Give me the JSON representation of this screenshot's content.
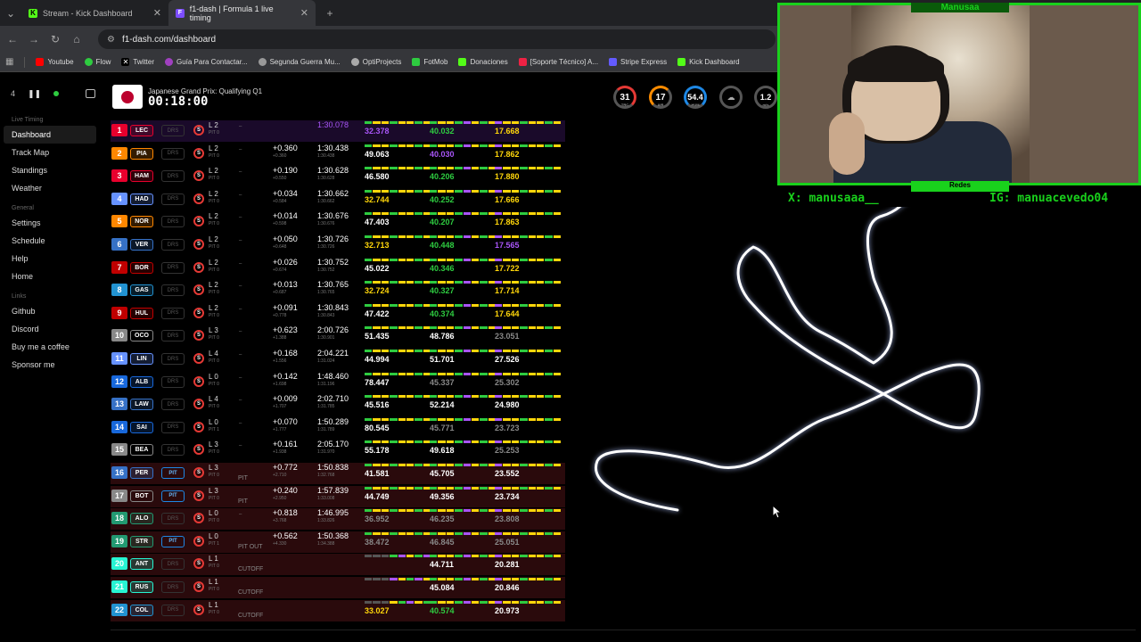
{
  "browser": {
    "tabs": [
      {
        "label": "Stream - Kick Dashboard",
        "icon": "kick-icon"
      },
      {
        "label": "f1-dash | Formula 1 live timing",
        "icon": "f1dash-icon"
      }
    ],
    "url": "f1-dash.com/dashboard",
    "bookmarks": [
      "Youtube",
      "Flow",
      "Twitter",
      "Guía Para Contactar...",
      "Segunda Guerra Mu...",
      "OptiProjects",
      "FotMob",
      "Donaciones",
      "[Soporte Técnico] A...",
      "Stripe Express",
      "Kick Dashboard"
    ]
  },
  "sidebar": {
    "count": "4",
    "groups": [
      {
        "title": "Live Timing",
        "items": [
          "Dashboard",
          "Track Map",
          "Standings",
          "Weather"
        ]
      },
      {
        "title": "General",
        "items": [
          "Settings",
          "Schedule",
          "Help",
          "Home"
        ]
      },
      {
        "title": "Links",
        "items": [
          "Github",
          "Discord",
          "Buy me a coffee",
          "Sponsor me"
        ]
      }
    ]
  },
  "header": {
    "session": "Japanese Grand Prix: Qualifying Q1",
    "timer": "00:18:00",
    "weather": [
      {
        "value": "31",
        "label": "TRC"
      },
      {
        "value": "17",
        "label": "AIR"
      },
      {
        "value": "54.4",
        "label": "HUM"
      },
      {
        "value": "",
        "label": ""
      },
      {
        "value": "1.2",
        "label": "m/s"
      }
    ]
  },
  "drivers": [
    {
      "pos": "1",
      "code": "LEC",
      "color": "#e8002d",
      "drs": "DRS",
      "lap": "L 2",
      "pit": "PIT 0",
      "status": "",
      "gap": "",
      "gapSub": "",
      "best": "1:30.078",
      "bestSub": "",
      "s1": "32.378",
      "s2": "40.032",
      "s3": "17.668",
      "s1c": "#a855f7",
      "s2c": "#2ecc40",
      "s3c": "#ffd60a",
      "rowStyle": "fastest"
    },
    {
      "pos": "2",
      "code": "PIA",
      "color": "#ff8700",
      "drs": "DRS",
      "lap": "L 2",
      "pit": "PIT 0",
      "status": "",
      "gap": "+0.360",
      "gapSub": "+0.360",
      "best": "1:30.438",
      "bestSub": "1:30.438",
      "s1": "49.063",
      "s2": "40.030",
      "s3": "17.862",
      "s1c": "#fff",
      "s2c": "#a855f7",
      "s3c": "#ffd60a",
      "rowStyle": ""
    },
    {
      "pos": "3",
      "code": "HAM",
      "color": "#e8002d",
      "drs": "DRS",
      "lap": "L 2",
      "pit": "PIT 0",
      "status": "",
      "gap": "+0.190",
      "gapSub": "+0.550",
      "best": "1:30.628",
      "bestSub": "1:30.628",
      "s1": "46.580",
      "s2": "40.206",
      "s3": "17.880",
      "s1c": "#fff",
      "s2c": "#2ecc40",
      "s3c": "#ffd60a",
      "rowStyle": ""
    },
    {
      "pos": "4",
      "code": "HAD",
      "color": "#6692ff",
      "drs": "DRS",
      "lap": "L 2",
      "pit": "PIT 0",
      "status": "",
      "gap": "+0.034",
      "gapSub": "+0.584",
      "best": "1:30.662",
      "bestSub": "1:30.662",
      "s1": "32.744",
      "s2": "40.252",
      "s3": "17.666",
      "s1c": "#ffd60a",
      "s2c": "#2ecc40",
      "s3c": "#ffd60a",
      "rowStyle": ""
    },
    {
      "pos": "5",
      "code": "NOR",
      "color": "#ff8700",
      "drs": "DRS",
      "lap": "L 2",
      "pit": "PIT 0",
      "status": "",
      "gap": "+0.014",
      "gapSub": "+0.598",
      "best": "1:30.676",
      "bestSub": "1:30.676",
      "s1": "47.403",
      "s2": "40.207",
      "s3": "17.863",
      "s1c": "#fff",
      "s2c": "#2ecc40",
      "s3c": "#ffd60a",
      "rowStyle": ""
    },
    {
      "pos": "6",
      "code": "VER",
      "color": "#3671c6",
      "drs": "DRS",
      "lap": "L 2",
      "pit": "PIT 0",
      "status": "",
      "gap": "+0.050",
      "gapSub": "+0.648",
      "best": "1:30.726",
      "bestSub": "1:30.726",
      "s1": "32.713",
      "s2": "40.448",
      "s3": "17.565",
      "s1c": "#ffd60a",
      "s2c": "#2ecc40",
      "s3c": "#a855f7",
      "rowStyle": ""
    },
    {
      "pos": "7",
      "code": "BOR",
      "color": "#c00000",
      "drs": "DRS",
      "lap": "L 2",
      "pit": "PIT 0",
      "status": "",
      "gap": "+0.026",
      "gapSub": "+0.674",
      "best": "1:30.752",
      "bestSub": "1:30.752",
      "s1": "45.022",
      "s2": "40.346",
      "s3": "17.722",
      "s1c": "#fff",
      "s2c": "#2ecc40",
      "s3c": "#ffd60a",
      "rowStyle": ""
    },
    {
      "pos": "8",
      "code": "GAS",
      "color": "#2293d1",
      "drs": "DRS",
      "lap": "L 2",
      "pit": "PIT 0",
      "status": "",
      "gap": "+0.013",
      "gapSub": "+0.687",
      "best": "1:30.765",
      "bestSub": "1:30.765",
      "s1": "32.724",
      "s2": "40.327",
      "s3": "17.714",
      "s1c": "#ffd60a",
      "s2c": "#2ecc40",
      "s3c": "#ffd60a",
      "rowStyle": ""
    },
    {
      "pos": "9",
      "code": "HUL",
      "color": "#c00000",
      "drs": "DRS",
      "lap": "L 2",
      "pit": "PIT 0",
      "status": "",
      "gap": "+0.091",
      "gapSub": "+0.778",
      "best": "1:30.843",
      "bestSub": "1:30.843",
      "s1": "47.422",
      "s2": "40.374",
      "s3": "17.644",
      "s1c": "#fff",
      "s2c": "#2ecc40",
      "s3c": "#ffd60a",
      "rowStyle": ""
    },
    {
      "pos": "10",
      "code": "OCO",
      "color": "#888",
      "drs": "DRS",
      "lap": "L 3",
      "pit": "PIT 0",
      "status": "",
      "gap": "+0.623",
      "gapSub": "+1.388",
      "best": "2:00.726",
      "bestSub": "1:30.901",
      "s1": "51.435",
      "s2": "48.786",
      "s3": "23.051",
      "s1c": "#fff",
      "s2c": "#fff",
      "s3c": "#888",
      "rowStyle": ""
    },
    {
      "pos": "11",
      "code": "LIN",
      "color": "#6692ff",
      "drs": "DRS",
      "lap": "L 4",
      "pit": "PIT 0",
      "status": "",
      "gap": "+0.168",
      "gapSub": "+1.556",
      "best": "2:04.221",
      "bestSub": "1:31.024",
      "s1": "44.994",
      "s2": "51.701",
      "s3": "27.526",
      "s1c": "#fff",
      "s2c": "#fff",
      "s3c": "#fff",
      "rowStyle": ""
    },
    {
      "pos": "12",
      "code": "ALB",
      "color": "#1868db",
      "drs": "DRS",
      "lap": "L 0",
      "pit": "PIT 0",
      "status": "",
      "gap": "+0.142",
      "gapSub": "+1.698",
      "best": "1:48.460",
      "bestSub": "1:31.196",
      "s1": "78.447",
      "s2": "45.337",
      "s3": "25.302",
      "s1c": "#fff",
      "s2c": "#888",
      "s3c": "#888",
      "rowStyle": ""
    },
    {
      "pos": "13",
      "code": "LAW",
      "color": "#3671c6",
      "drs": "DRS",
      "lap": "L 4",
      "pit": "PIT 0",
      "status": "",
      "gap": "+0.009",
      "gapSub": "+1.707",
      "best": "2:02.710",
      "bestSub": "1:31.785",
      "s1": "45.516",
      "s2": "52.214",
      "s3": "24.980",
      "s1c": "#fff",
      "s2c": "#fff",
      "s3c": "#fff",
      "rowStyle": ""
    },
    {
      "pos": "14",
      "code": "SAI",
      "color": "#1868db",
      "drs": "DRS",
      "lap": "L 0",
      "pit": "PIT 1",
      "status": "",
      "gap": "+0.070",
      "gapSub": "+1.777",
      "best": "1:50.289",
      "bestSub": "1:31.789",
      "s1": "80.545",
      "s2": "45.771",
      "s3": "23.723",
      "s1c": "#fff",
      "s2c": "#888",
      "s3c": "#888",
      "rowStyle": ""
    },
    {
      "pos": "15",
      "code": "BEA",
      "color": "#888",
      "drs": "DRS",
      "lap": "L 3",
      "pit": "PIT 0",
      "status": "",
      "gap": "+0.161",
      "gapSub": "+1.938",
      "best": "2:05.170",
      "bestSub": "1:31.970",
      "s1": "55.178",
      "s2": "49.618",
      "s3": "25.253",
      "s1c": "#fff",
      "s2c": "#fff",
      "s3c": "#888",
      "rowStyle": ""
    },
    {
      "pos": "16",
      "code": "PER",
      "color": "#3671c6",
      "drs": "PIT",
      "lap": "L 3",
      "pit": "PIT 0",
      "status": "PIT",
      "gap": "+0.772",
      "gapSub": "+2.710",
      "best": "1:50.838",
      "bestSub": "1:32.768",
      "s1": "41.581",
      "s2": "45.705",
      "s3": "23.552",
      "s1c": "#fff",
      "s2c": "#fff",
      "s3c": "#fff",
      "rowStyle": "pit"
    },
    {
      "pos": "17",
      "code": "BOT",
      "color": "#888",
      "drs": "PIT",
      "lap": "L 3",
      "pit": "PIT 0",
      "status": "PIT",
      "gap": "+0.240",
      "gapSub": "+2.950",
      "best": "1:57.839",
      "bestSub": "1:33.008",
      "s1": "44.749",
      "s2": "49.356",
      "s3": "23.734",
      "s1c": "#fff",
      "s2c": "#fff",
      "s3c": "#fff",
      "rowStyle": "pit"
    },
    {
      "pos": "18",
      "code": "ALO",
      "color": "#229971",
      "drs": "DRS",
      "lap": "L 0",
      "pit": "PIT 0",
      "status": "",
      "gap": "+0.818",
      "gapSub": "+3.768",
      "best": "1:46.995",
      "bestSub": "1:33.826",
      "s1": "36.952",
      "s2": "46.235",
      "s3": "23.808",
      "s1c": "#888",
      "s2c": "#888",
      "s3c": "#888",
      "rowStyle": "pit"
    },
    {
      "pos": "19",
      "code": "STR",
      "color": "#229971",
      "drs": "PIT",
      "lap": "L 0",
      "pit": "PIT 1",
      "status": "PIT OUT",
      "gap": "+0.562",
      "gapSub": "+4.330",
      "best": "1:50.368",
      "bestSub": "1:34.388",
      "s1": "38.472",
      "s2": "46.845",
      "s3": "25.051",
      "s1c": "#888",
      "s2c": "#888",
      "s3c": "#888",
      "rowStyle": "pit"
    },
    {
      "pos": "20",
      "code": "ANT",
      "color": "#27f4d2",
      "drs": "DRS",
      "lap": "L 1",
      "pit": "PIT 0",
      "status": "CUTOFF",
      "gap": "",
      "gapSub": "",
      "best": "",
      "bestSub": "",
      "s1": "",
      "s2": "44.711",
      "s3": "20.281",
      "s1c": "#888",
      "s2c": "#fff",
      "s3c": "#fff",
      "rowStyle": "pit"
    },
    {
      "pos": "21",
      "code": "RUS",
      "color": "#27f4d2",
      "drs": "DRS",
      "lap": "L 1",
      "pit": "PIT 0",
      "status": "CUTOFF",
      "gap": "",
      "gapSub": "",
      "best": "",
      "bestSub": "",
      "s1": "",
      "s2": "45.084",
      "s3": "20.846",
      "s1c": "#888",
      "s2c": "#fff",
      "s3c": "#fff",
      "rowStyle": "pit"
    },
    {
      "pos": "22",
      "code": "COL",
      "color": "#2293d1",
      "drs": "DRS",
      "lap": "L 1",
      "pit": "PIT 0",
      "status": "CUTOFF",
      "gap": "",
      "gapSub": "",
      "best": "",
      "bestSub": "",
      "s1": "33.027",
      "s2": "40.574",
      "s3": "20.973",
      "s1c": "#ffd60a",
      "s2c": "#2ecc40",
      "s3c": "#fff",
      "rowStyle": "pit"
    }
  ],
  "stream": {
    "name": "Manusaa",
    "redes": "Redes",
    "x_handle": "X: manusaaa__",
    "ig_handle": "IG: manuacevedo04"
  }
}
